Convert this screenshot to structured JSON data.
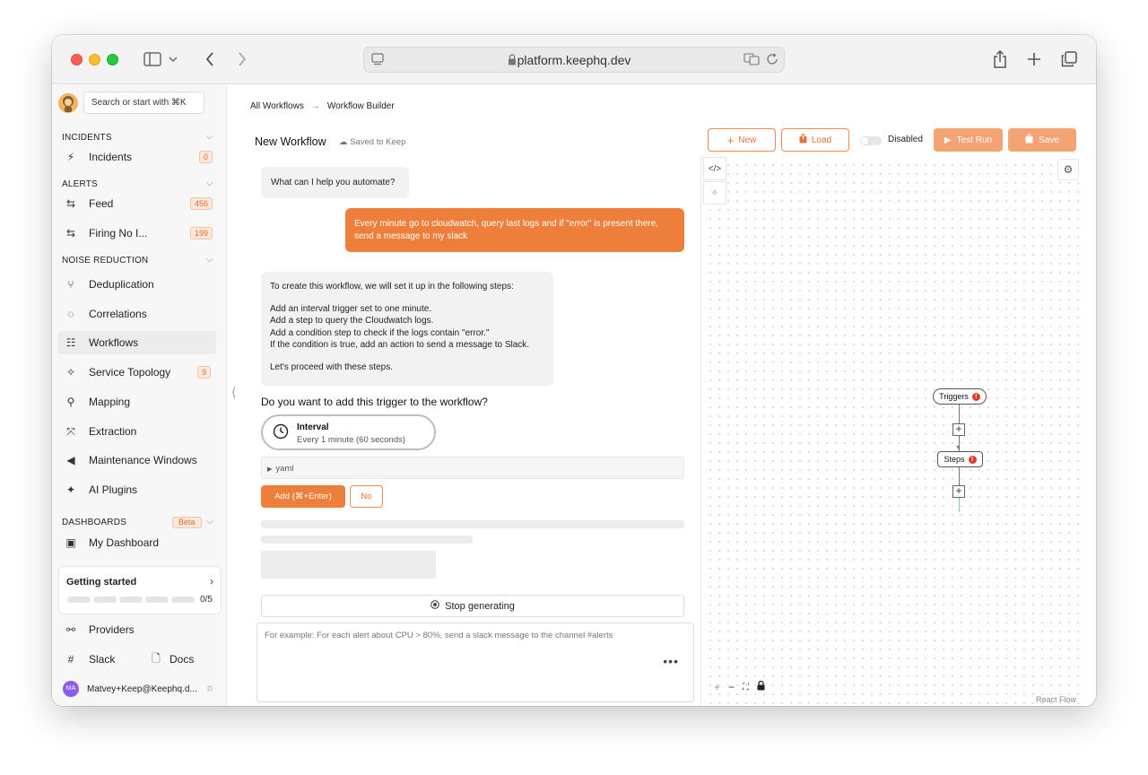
{
  "browser": {
    "url": "platform.keephq.dev"
  },
  "sidebar": {
    "search_placeholder": "Search or start with ⌘K",
    "sections": {
      "incidents": "INCIDENTS",
      "alerts": "ALERTS",
      "noise_reduction": "NOISE REDUCTION",
      "dashboards": "DASHBOARDS"
    },
    "dashboards_badge": "Beta",
    "items": [
      {
        "label": "Incidents",
        "count": "0",
        "icon": "lightning-icon"
      },
      {
        "label": "Feed",
        "count": "456",
        "icon": "arrows-icon"
      },
      {
        "label": "Firing No I...",
        "count": "199",
        "icon": "arrows-icon"
      },
      {
        "label": "Deduplication",
        "icon": "merge-icon"
      },
      {
        "label": "Correlations",
        "icon": "correlation-icon"
      },
      {
        "label": "Workflows",
        "icon": "workflow-icon"
      },
      {
        "label": "Service Topology",
        "count": "9",
        "icon": "topology-icon"
      },
      {
        "label": "Mapping",
        "icon": "mapping-icon"
      },
      {
        "label": "Extraction",
        "icon": "extraction-icon"
      },
      {
        "label": "Maintenance Windows",
        "icon": "mute-icon"
      },
      {
        "label": "AI Plugins",
        "icon": "sparkles-icon"
      },
      {
        "label": "My Dashboard",
        "icon": "dashboard-icon"
      }
    ],
    "getting_started": {
      "title": "Getting started",
      "progress": "0/5"
    },
    "providers": "Providers",
    "slack": "Slack",
    "docs": "Docs",
    "user": {
      "initials": "MA",
      "name": "Matvey+Keep@Keephq.d..."
    }
  },
  "main": {
    "breadcrumb": {
      "root": "All Workflows",
      "current": "Workflow Builder"
    },
    "title": "New Workflow",
    "saved_status": "Saved to Keep",
    "buttons": {
      "new": "New",
      "load": "Load",
      "test_run": "Test Run",
      "save": "Save"
    },
    "toggle_label": "Disabled"
  },
  "chat": {
    "greeting": "What can I help you automate?",
    "user_message": "Every minute go to cloudwatch, query last logs and if \"error\" is present there, send a message to my slack",
    "ai_intro": "To create this workflow, we will set it up in the following steps:",
    "ai_steps": [
      "Add an interval trigger set to one minute.",
      "Add a step to query the Cloudwatch logs.",
      "Add a condition step to check if the logs contain \"error.\"",
      "If the condition is true, add an action to send a message to Slack."
    ],
    "ai_outro": "Let's proceed with these steps.",
    "question": "Do you want to add this trigger to the workflow?",
    "trigger_card": {
      "title": "Interval",
      "subtitle": "Every 1 minute (60 seconds)"
    },
    "yaml_label": "yaml",
    "add_button": "Add (⌘+Enter)",
    "no_button": "No",
    "stop_button": "Stop generating",
    "input_placeholder": "For example: For each alert about CPU > 80%, send a slack message to the channel #alerts"
  },
  "canvas": {
    "nodes": {
      "triggers": "Triggers",
      "steps": "Steps"
    },
    "error_mark": "!",
    "credit": "React Flow"
  },
  "colors": {
    "accent": "#ee7f3b",
    "accent_light": "#f4a474",
    "error": "#e0392b"
  }
}
